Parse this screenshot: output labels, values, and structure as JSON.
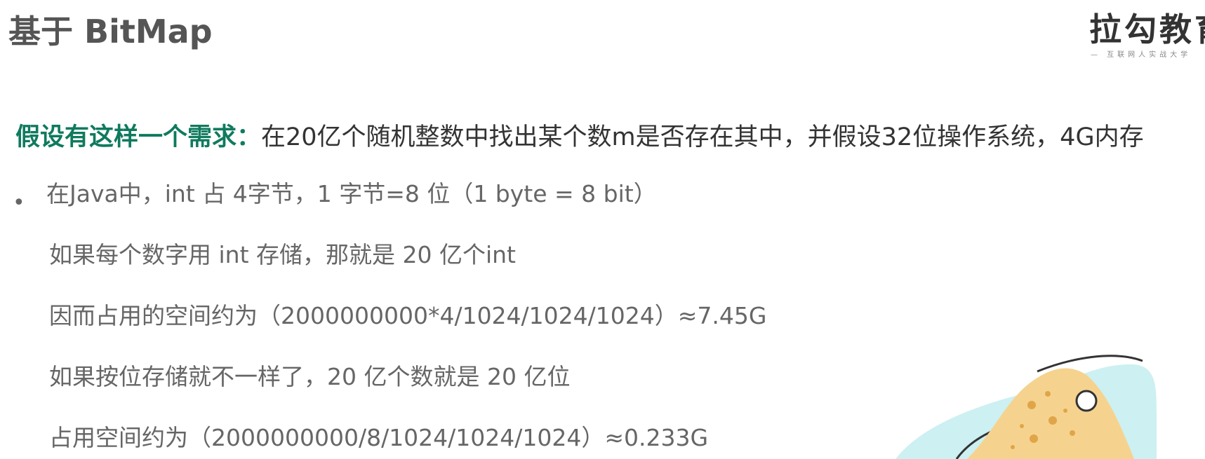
{
  "slide": {
    "title": "基于 BitMap",
    "logo": {
      "name": "拉勾教育",
      "tagline": "— 互联网人实战大学"
    },
    "requirement": {
      "label": "假设有这样一个需求：",
      "text": "在20亿个随机整数中找出某个数m是否存在其中，并假设32位操作系统，4G内存"
    },
    "bullet_symbol": "•",
    "lines": [
      "在Java中，int 占 4字节，1 字节=8 位（1 byte = 8 bit）",
      "如果每个数字用 int 存储，那就是 20 亿个int",
      "因而占用的空间约为（2000000000*4/1024/1024/1024）≈7.45G",
      "如果按位存储就不一样了，20 亿个数就是 20 亿位",
      "占用空间约为（2000000000/8/1024/1024/1024）≈0.233G"
    ]
  },
  "colors": {
    "title": "#555555",
    "accent_green": "#0f7a5e",
    "requirement_text": "#333333",
    "body_text": "#666666",
    "logo": "#333333",
    "logo_sub": "#888888",
    "deco_cyan": "#cdf0f2",
    "deco_sand": "#f5d38f",
    "deco_dots": "#e0a548",
    "deco_outline": "#333333"
  }
}
